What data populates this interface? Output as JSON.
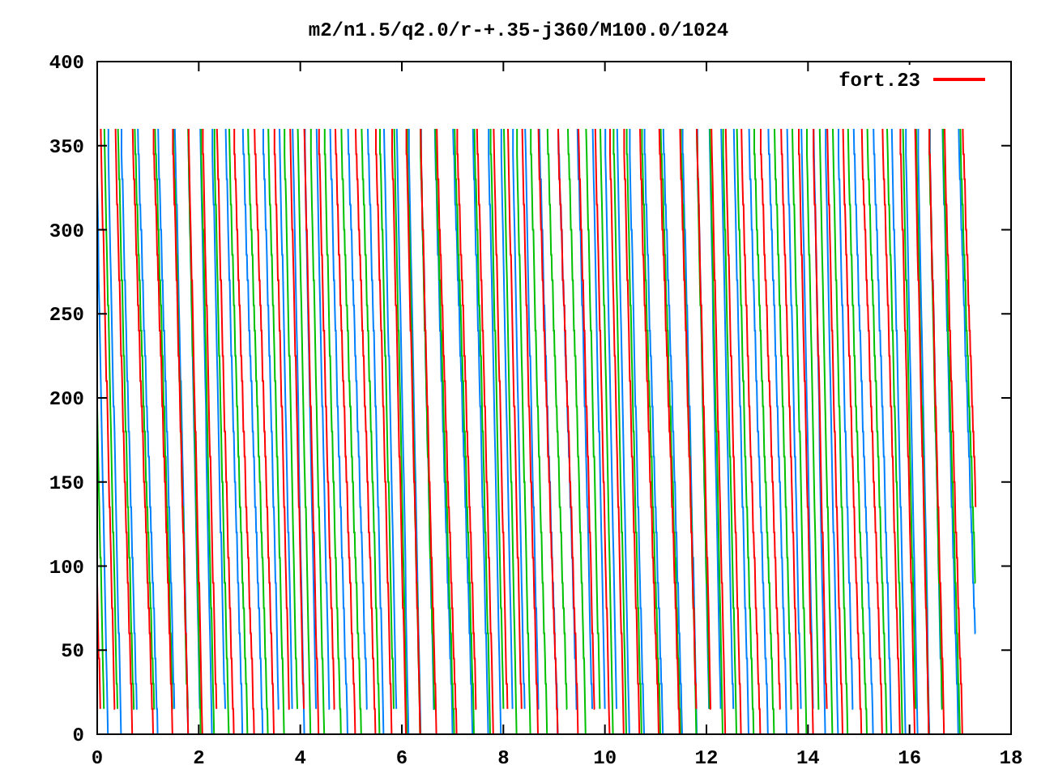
{
  "title": "m2/n1.5/q2.0/r-+.35-j360/M100.0/1024",
  "legend": {
    "label": "fort.23",
    "color": "#ff0000"
  },
  "xticks": [
    "0",
    "2",
    "4",
    "6",
    "8",
    "10",
    "12",
    "14",
    "16",
    "18"
  ],
  "yticks": [
    "400",
    "350",
    "300",
    "250",
    "200",
    "150",
    "100",
    "50",
    "0"
  ]
}
